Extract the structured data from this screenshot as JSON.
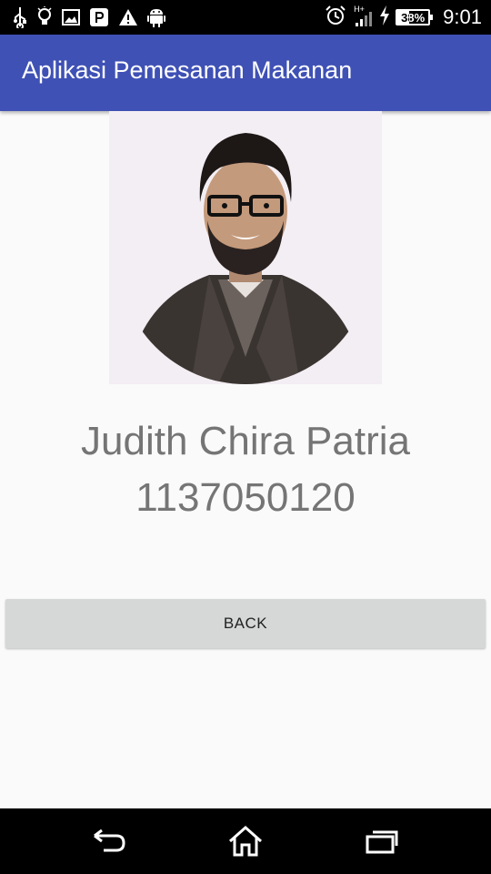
{
  "status_bar": {
    "network_label": "H+",
    "battery_text": "38%",
    "battery_level": 0.38,
    "time": "9:01",
    "icons": [
      "usb-icon",
      "bulb-icon",
      "image-icon",
      "p-app-icon",
      "warning-icon",
      "android-icon",
      "alarm-icon",
      "signal-icon",
      "charging-icon",
      "battery-icon"
    ]
  },
  "app_bar": {
    "title": "Aplikasi Pemesanan Makanan"
  },
  "profile": {
    "name": "Judith Chira Patria",
    "nim": "1137050120"
  },
  "actions": {
    "back_label": "BACK"
  },
  "nav_bar": {
    "icons": [
      "back-icon",
      "home-icon",
      "recents-icon"
    ]
  },
  "colors": {
    "primary": "#3f51b5",
    "status_bar": "#000000",
    "background": "#fafafa",
    "text_secondary": "#757575",
    "button": "#d6d7d7"
  }
}
